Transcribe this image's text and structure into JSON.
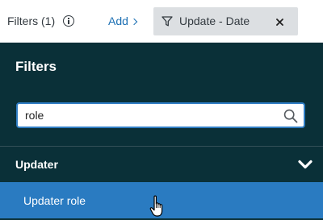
{
  "topbar": {
    "filters_label": "Filters (1)",
    "info_icon": "info-icon",
    "add_label": "Add",
    "chip": {
      "icon": "funnel-icon",
      "label": "Update - Date",
      "close_icon": "close-icon"
    }
  },
  "panel": {
    "title": "Filters",
    "search": {
      "value": "role",
      "icon": "search-icon"
    },
    "group": {
      "label": "Updater",
      "icon": "chevron-down-icon"
    },
    "results": [
      {
        "label": "Updater role",
        "highlighted": true
      }
    ]
  },
  "colors": {
    "panel_bg": "#0a3038",
    "accent": "#2a7bc1",
    "link": "#1b6fb3",
    "chip_bg": "#dcdfe2"
  }
}
